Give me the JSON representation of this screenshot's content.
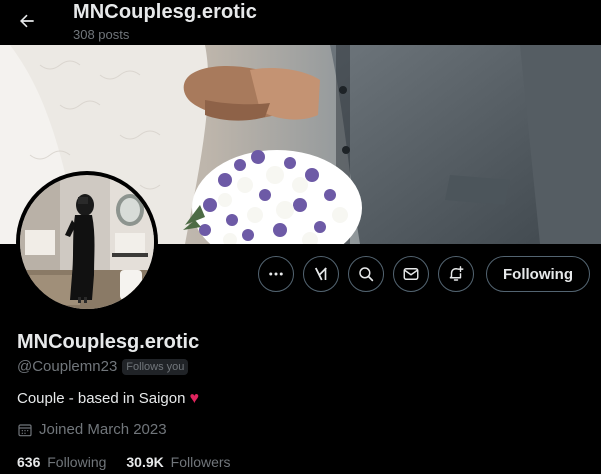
{
  "header": {
    "title": "MNCouplesg.erotic",
    "posts_count": "308 posts"
  },
  "profile": {
    "display_name": "MNCouplesg.erotic",
    "handle": "@Couplemn23",
    "follows_you_badge": "Follows you",
    "bio": "Couple - based in Saigon",
    "joined": "Joined March 2023",
    "following_count": "636",
    "following_label": "Following",
    "followers_count": "30.9K",
    "followers_label": "Followers"
  },
  "actions": {
    "follow_button_label": "Following",
    "icons": [
      "more-icon",
      "grok-icon",
      "search-icon",
      "message-icon",
      "notification-bell-icon"
    ]
  },
  "colors": {
    "background": "#000000",
    "text_primary": "#e7e9ea",
    "text_secondary": "#71767b",
    "border": "#536471",
    "heart": "#e0245e"
  }
}
